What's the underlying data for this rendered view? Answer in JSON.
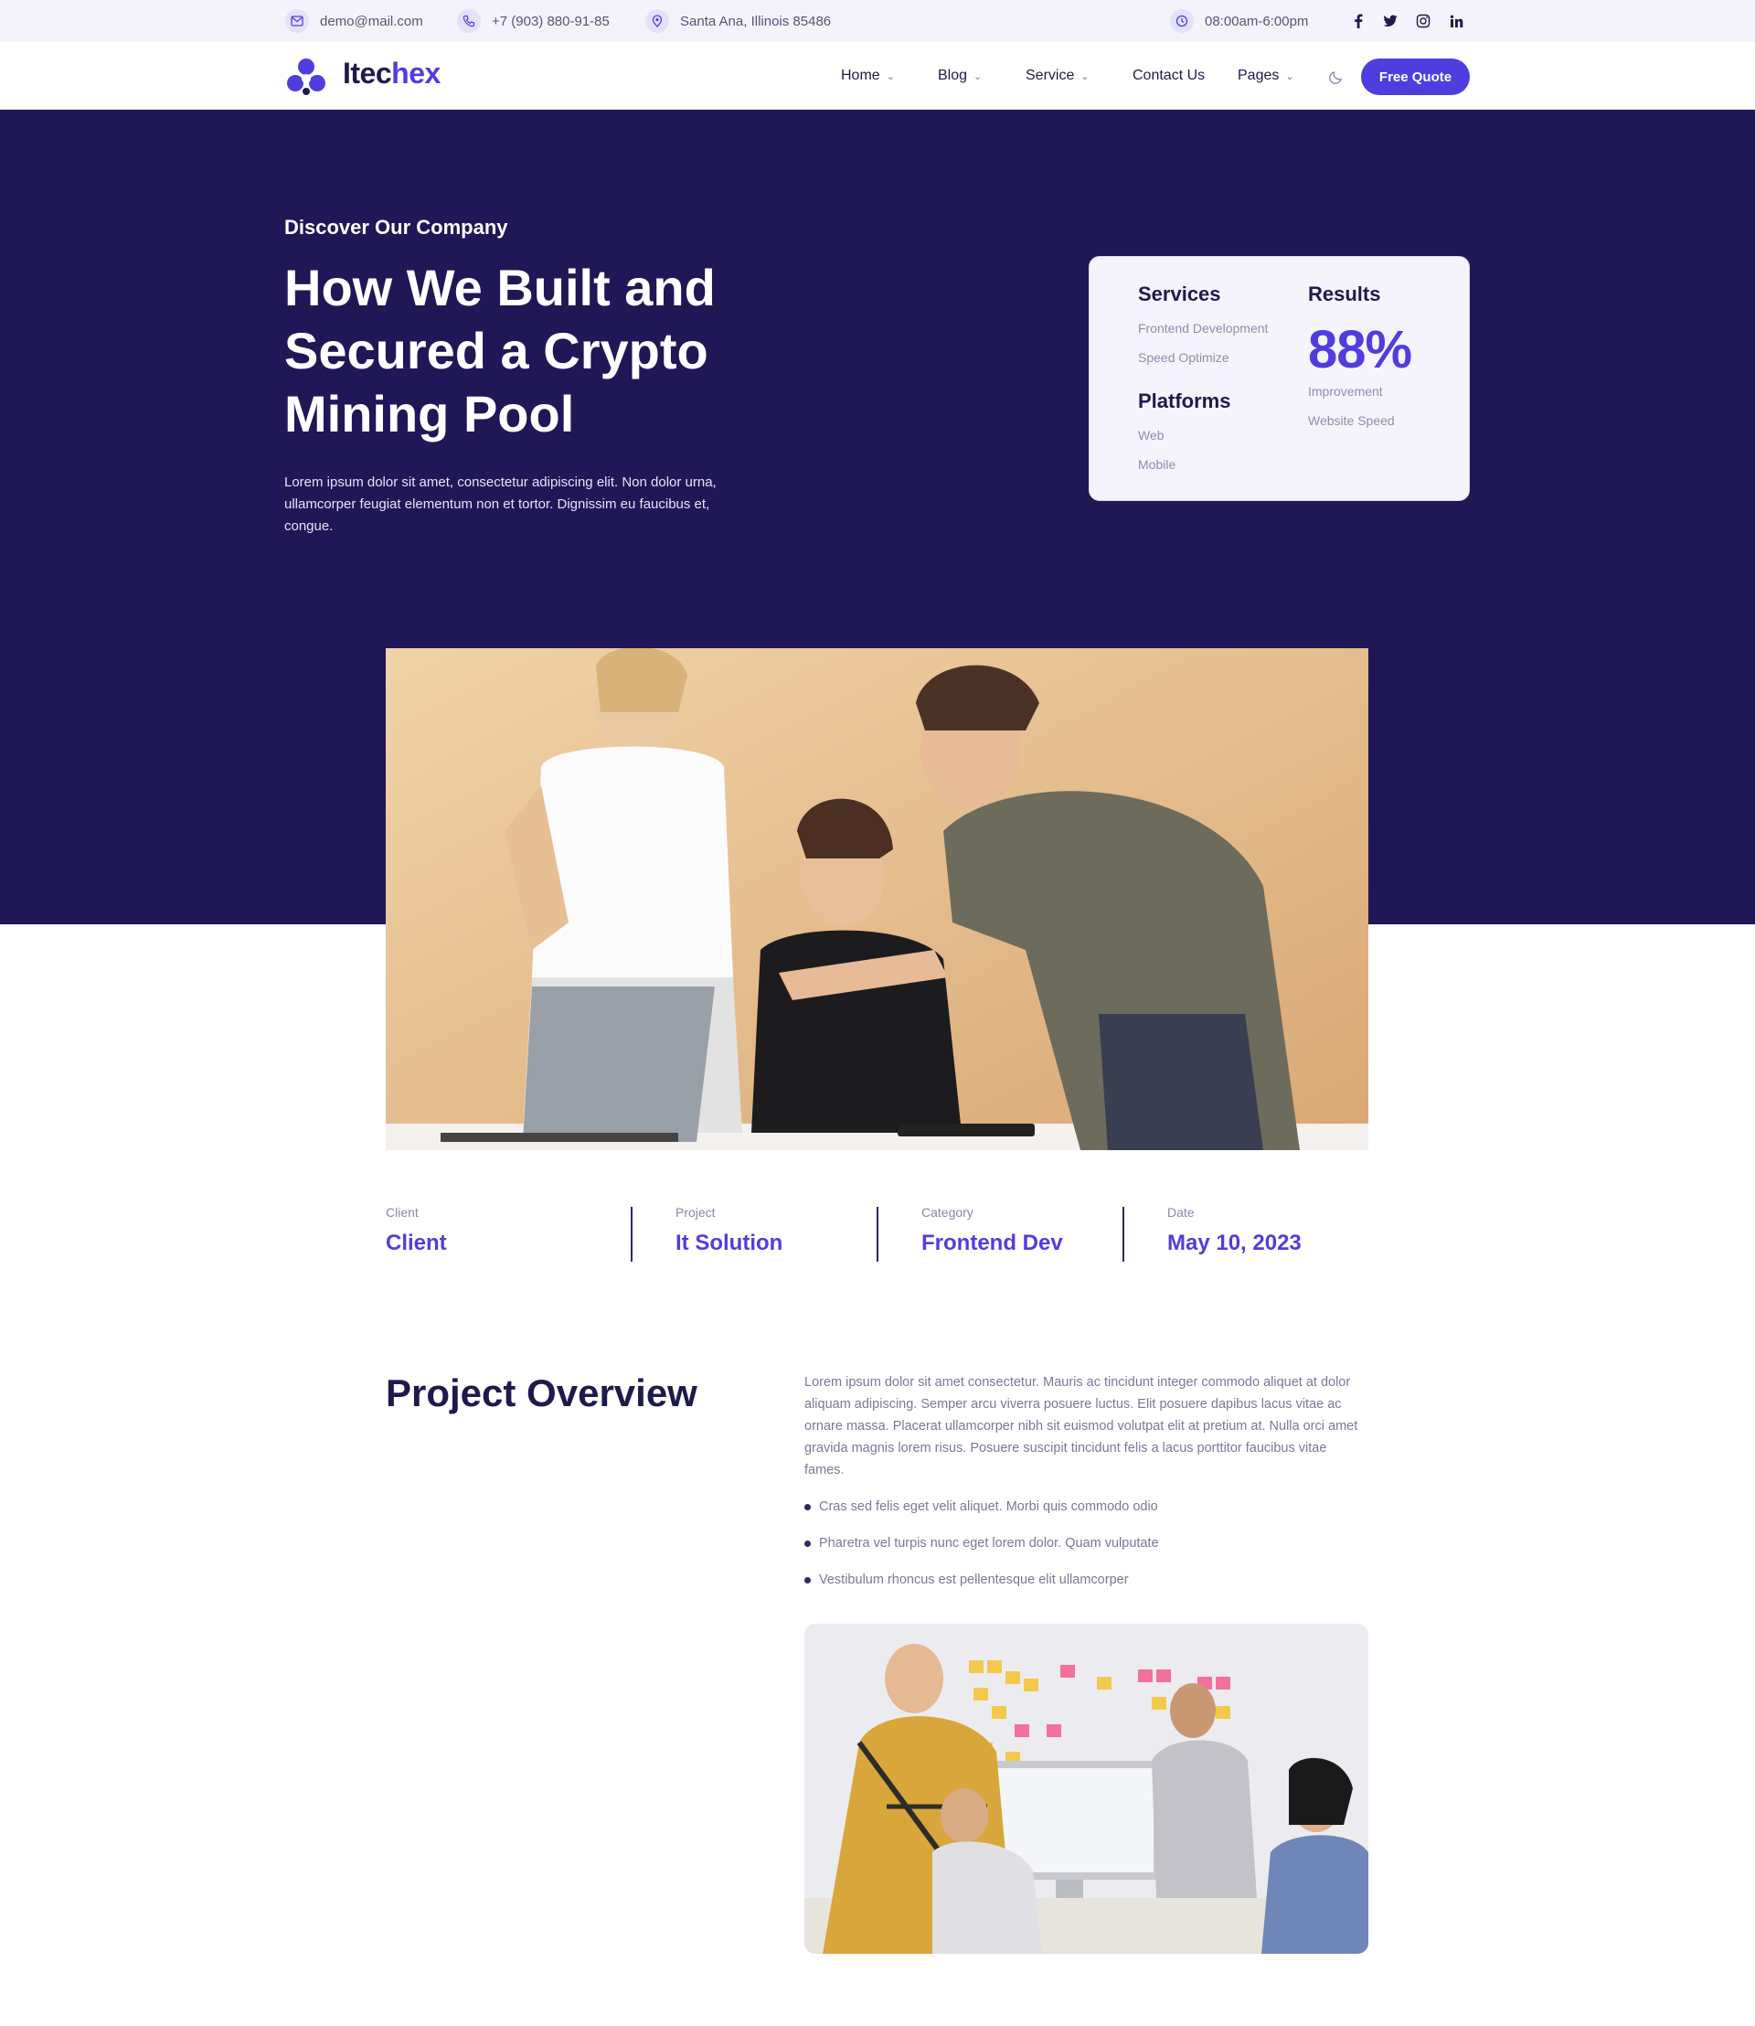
{
  "topbar": {
    "email": "demo@mail.com",
    "phone": "+7 (903) 880-91-85",
    "address": "Santa Ana, Illinois 85486",
    "hours": "08:00am-6:00pm",
    "social_icons": [
      "facebook-icon",
      "twitter-icon",
      "instagram-icon",
      "linkedin-icon"
    ]
  },
  "nav": {
    "logo_part1": "Itec",
    "logo_part2": "hex",
    "menu": [
      {
        "label": "Home",
        "has_dropdown": true
      },
      {
        "label": "Blog",
        "has_dropdown": true
      },
      {
        "label": "Service",
        "has_dropdown": true
      },
      {
        "label": "Contact Us",
        "has_dropdown": false
      },
      {
        "label": "Pages",
        "has_dropdown": true
      }
    ],
    "cta": "Free Quote"
  },
  "hero": {
    "eyebrow": "Discover Our Company",
    "title": "How We Built and Secured a Crypto Mining Pool",
    "description": "Lorem ipsum dolor sit amet, consectetur adipiscing elit. Non dolor urna, ullamcorper feugiat elementum non et tortor. Dignissim eu faucibus et, congue."
  },
  "stat_card": {
    "services_heading": "Services",
    "services": [
      "Frontend Development",
      "Speed Optimize"
    ],
    "platforms_heading": "Platforms",
    "platforms": [
      "Web",
      "Mobile"
    ],
    "results_heading": "Results",
    "result_value": "88%",
    "result_lines": [
      "Improvement",
      "Website Speed"
    ]
  },
  "info": [
    {
      "label": "Client",
      "value": "Client"
    },
    {
      "label": "Project",
      "value": "It Solution"
    },
    {
      "label": "Category",
      "value": "Frontend Dev"
    },
    {
      "label": "Date",
      "value": "May 10, 2023"
    }
  ],
  "overview": {
    "title": "Project Overview",
    "text": "Lorem ipsum dolor sit amet consectetur. Mauris ac tincidunt integer commodo aliquet at dolor aliquam adipiscing. Semper arcu viverra posuere luctus. Elit posuere dapibus lacus vitae ac ornare massa. Placerat ullamcorper nibh sit euismod volutpat elit at pretium at. Nulla orci amet gravida magnis lorem risus. Posuere suscipit tincidunt felis a lacus porttitor faucibus vitae fames.",
    "bullets": [
      "Cras sed felis eget velit aliquet. Morbi quis commodo odio",
      "Pharetra vel turpis nunc eget lorem dolor. Quam vulputate",
      "Vestibulum rhoncus est pellentesque elit ullamcorper"
    ]
  },
  "colors": {
    "brand": "#4f3de0",
    "hero_bg": "#201756",
    "heading": "#1e1a4d"
  }
}
